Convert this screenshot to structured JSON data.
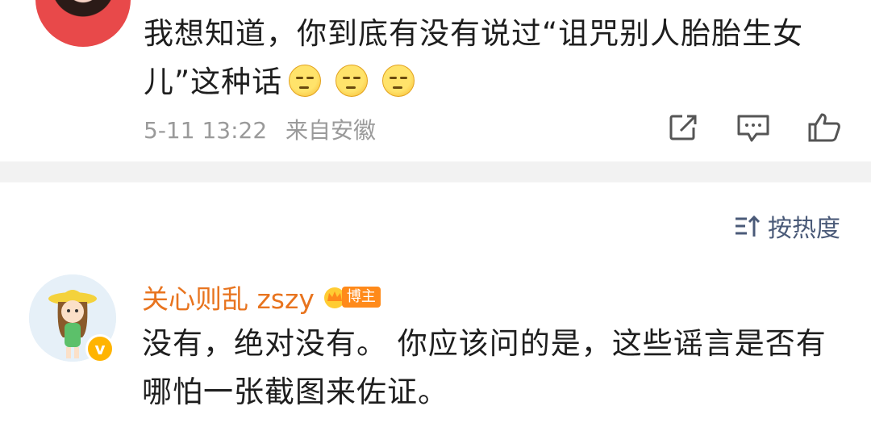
{
  "post": {
    "text_line1": "我想知道，你到底有没有说过“诅咒别人胎胎生女",
    "text_line2": "儿”这种话",
    "emojis": [
      "sleepy-emoji",
      "sleepy-emoji",
      "sleepy-emoji"
    ],
    "date": "5-11 13:22",
    "source": "来自安徽",
    "actions": [
      "share-icon",
      "comment-icon",
      "like-icon"
    ]
  },
  "sort": {
    "label": "按热度",
    "icon": "sort-icon"
  },
  "reply": {
    "username": "关心则乱 zszy",
    "badge_label": "博主",
    "verified_mark": "v",
    "text_line1": "没有，绝对没有。 你应该问的是，这些谣言是否有",
    "text_line2": "哪怕一张截图来佐证。"
  },
  "colors": {
    "username": "#e8741f",
    "meta": "#9a9a9a",
    "sort": "#4a5a78",
    "band": "#f2f2f2",
    "badge": "#ff8a1a",
    "verified": "#ffb400"
  }
}
